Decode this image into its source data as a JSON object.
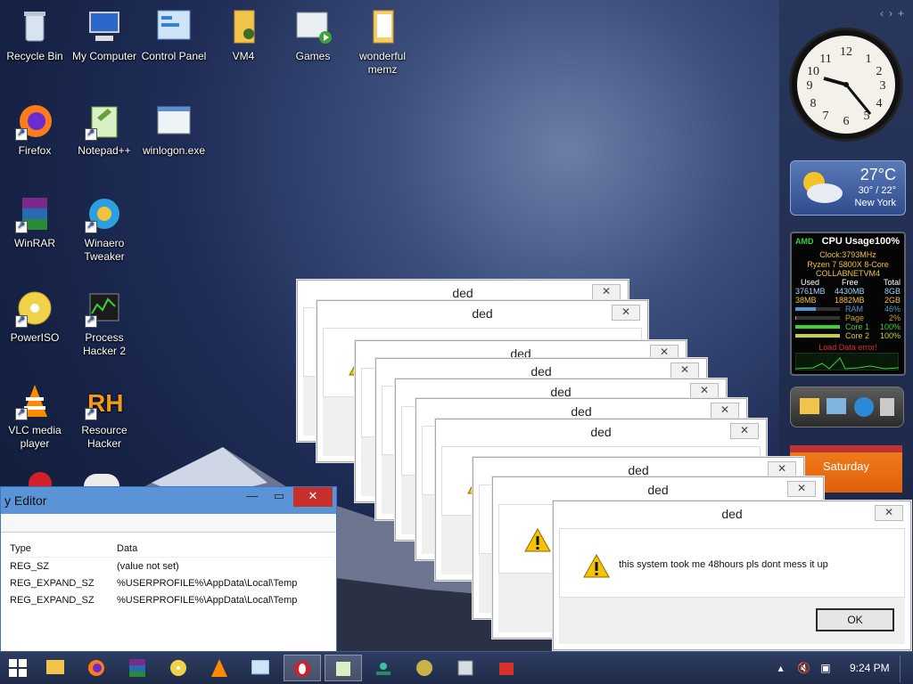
{
  "desktop": {
    "icons": [
      {
        "label": "Recycle Bin"
      },
      {
        "label": "My Computer"
      },
      {
        "label": "Control Panel"
      },
      {
        "label": "VM4"
      },
      {
        "label": "Games"
      },
      {
        "label": "wonderful memz"
      },
      {
        "label": "Firefox"
      },
      {
        "label": "Notepad++"
      },
      {
        "label": "winlogon.exe"
      },
      {
        "label": "WinRAR"
      },
      {
        "label": "Winaero Tweaker"
      },
      {
        "label": "PowerISO"
      },
      {
        "label": "Process Hacker 2"
      },
      {
        "label": "VLC media player"
      },
      {
        "label": "Resource Hacker"
      }
    ]
  },
  "gadgets": {
    "weather": {
      "temp": "27°C",
      "range": "30° / 22°",
      "city": "New York"
    },
    "cpu": {
      "title": "CPU Usage",
      "percent": "100%",
      "brand": "AMD",
      "clock": "Clock:3793MHz",
      "model": "Ryzen 7 5800X 8-Core",
      "host": "COLLABNETVM4",
      "mem_headers": [
        "Used",
        "Free",
        "Total"
      ],
      "mem_rows": [
        [
          "3761MB",
          "4430MB",
          "8GB"
        ],
        [
          "38MB",
          "1882MB",
          "2GB"
        ]
      ],
      "bars": [
        {
          "label": "RAM",
          "value": "46%",
          "level": 0.46
        },
        {
          "label": "Page",
          "value": "2%",
          "level": 0.02
        },
        {
          "label": "Core 1",
          "value": "100%",
          "level": 1.0
        },
        {
          "label": "Core 2",
          "value": "100%",
          "level": 1.0
        }
      ],
      "error": "Load Data error!"
    },
    "calendar": {
      "day": "Saturday"
    }
  },
  "regedit": {
    "title": "y Editor",
    "columns": [
      "Type",
      "Data"
    ],
    "rows": [
      [
        "REG_SZ",
        "(value not set)"
      ],
      [
        "REG_EXPAND_SZ",
        "%USERPROFILE%\\AppData\\Local\\Temp"
      ],
      [
        "REG_EXPAND_SZ",
        "%USERPROFILE%\\AppData\\Local\\Temp"
      ]
    ]
  },
  "dialog": {
    "title": "ded",
    "message": "this system took me 48hours pls dont mess it up",
    "ok_label": "OK",
    "close_glyph": "✕"
  },
  "taskbar": {
    "time": "9:24 PM"
  }
}
